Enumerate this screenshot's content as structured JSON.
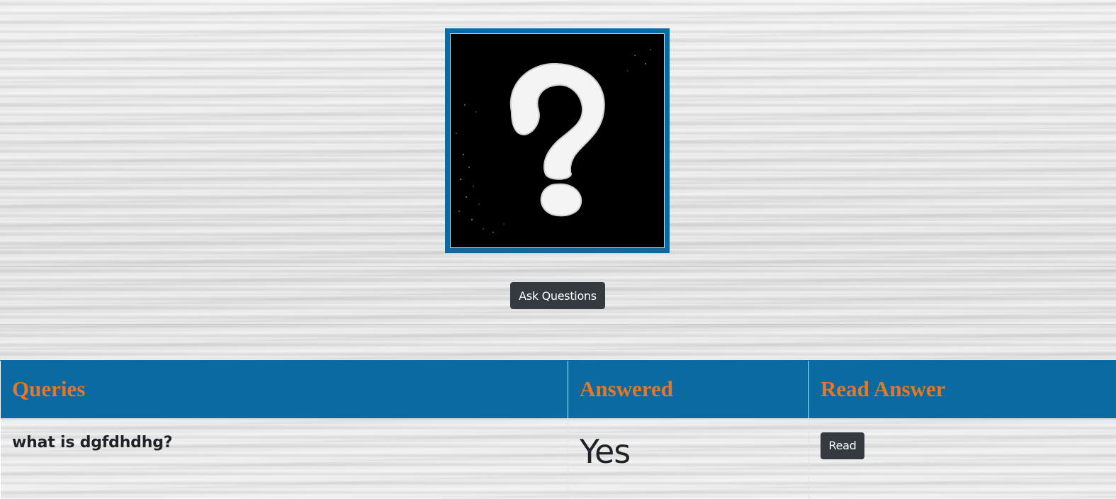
{
  "logo": {
    "icon": "question-mark-icon",
    "frame_color": "#0a6aa1"
  },
  "actions": {
    "ask_label": "Ask Questions"
  },
  "table": {
    "headers": {
      "queries": "Queries",
      "answered": "Answered",
      "read_answer": "Read Answer"
    },
    "rows": [
      {
        "query": "what is dgfdhdhg?",
        "answered": "Yes",
        "read_label": "Read"
      }
    ]
  },
  "colors": {
    "header_bg": "#0a6aa1",
    "header_text": "#e87722",
    "button_bg": "#343a40"
  }
}
